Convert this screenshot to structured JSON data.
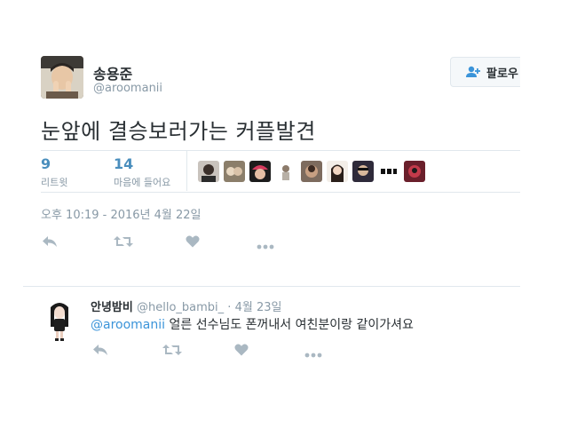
{
  "tweet": {
    "author": {
      "name": "송용준",
      "handle": "@aroomanii"
    },
    "follow_label": "팔로우",
    "text": "눈앞에 결승보러가는 커플발견",
    "stats": {
      "retweets": {
        "count": "9",
        "label": "리트윗"
      },
      "likes": {
        "count": "14",
        "label": "마음에 들어요"
      }
    },
    "timestamp": "오후 10:19 - 2016년 4월 22일"
  },
  "reply": {
    "name": "안녕밤비",
    "handle": "@hello_bambi_",
    "separator": "·",
    "date": "4월 23일",
    "mention": "@aroomanii",
    "text": " 얼른 선수님도 폰꺼내서 여친분이랑 같이가셔요"
  },
  "icons": [
    "reply-icon",
    "retweet-icon",
    "like-icon",
    "more-icon",
    "follow-person-icon"
  ],
  "colors": {
    "link": "#3b94d9",
    "stat_count": "#4a8ebd",
    "muted": "#8899a6",
    "icon": "#aab8c2"
  }
}
